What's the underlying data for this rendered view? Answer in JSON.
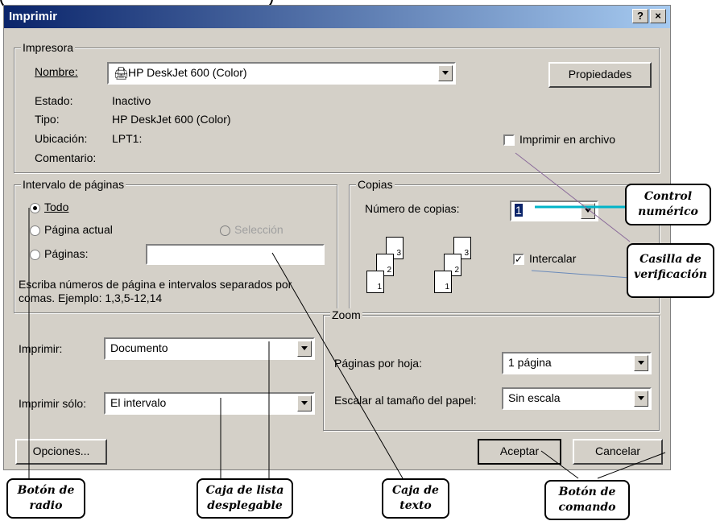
{
  "dialog": {
    "title": "Imprimir",
    "help_button": "?",
    "close_button": "×"
  },
  "printer": {
    "group_label": "Impresora",
    "name_label": "Nombre:",
    "name_value": "HP DeskJet 600 (Color)",
    "properties_button": "Propiedades",
    "status_label": "Estado:",
    "status_value": "Inactivo",
    "type_label": "Tipo:",
    "type_value": "HP DeskJet 600 (Color)",
    "location_label": "Ubicación:",
    "location_value": "LPT1:",
    "comment_label": "Comentario:",
    "print_to_file_label": "Imprimir en archivo",
    "print_to_file_checked": false
  },
  "range": {
    "group_label": "Intervalo de páginas",
    "all_label": "Todo",
    "current_label": "Página actual",
    "selection_label": "Selección",
    "pages_label": "Páginas:",
    "pages_value": "",
    "hint": "Escriba números de página e intervalos separados por comas. Ejemplo: 1,3,5-12,14",
    "selected": "all"
  },
  "copies": {
    "group_label": "Copias",
    "number_label": "Número de copias:",
    "number_value": "1",
    "collate_label": "Intercalar",
    "collate_checked": true,
    "page_numbers": [
      "1",
      "2",
      "3"
    ]
  },
  "print_what": {
    "label": "Imprimir:",
    "value": "Documento"
  },
  "print_only": {
    "label": "Imprimir sólo:",
    "value": "El intervalo"
  },
  "zoom": {
    "group_label": "Zoom",
    "pages_per_sheet_label": "Páginas por hoja:",
    "pages_per_sheet_value": "1 página",
    "scale_label": "Escalar al tamaño del papel:",
    "scale_value": "Sin escala"
  },
  "footer": {
    "options_button": "Opciones...",
    "ok_button": "Aceptar",
    "cancel_button": "Cancelar"
  },
  "callouts": {
    "numeric_control": "Control numérico",
    "checkbox": "Casilla de verificación",
    "radio_button": "Botón de radio",
    "dropdown_list": "Caja de lista desplegable",
    "text_box": "Caja de texto",
    "command_button": "Botón de comando"
  },
  "icons": {
    "printer": "printer-icon",
    "dropdown": "chevron-down-icon",
    "spinner": "spinner-arrows-icon"
  },
  "colors": {
    "titlebar_start": "#0a246a",
    "titlebar_end": "#a6caf0",
    "dialog_face": "#d4d0c8",
    "callout_line_cyan": "#00b4c8"
  }
}
